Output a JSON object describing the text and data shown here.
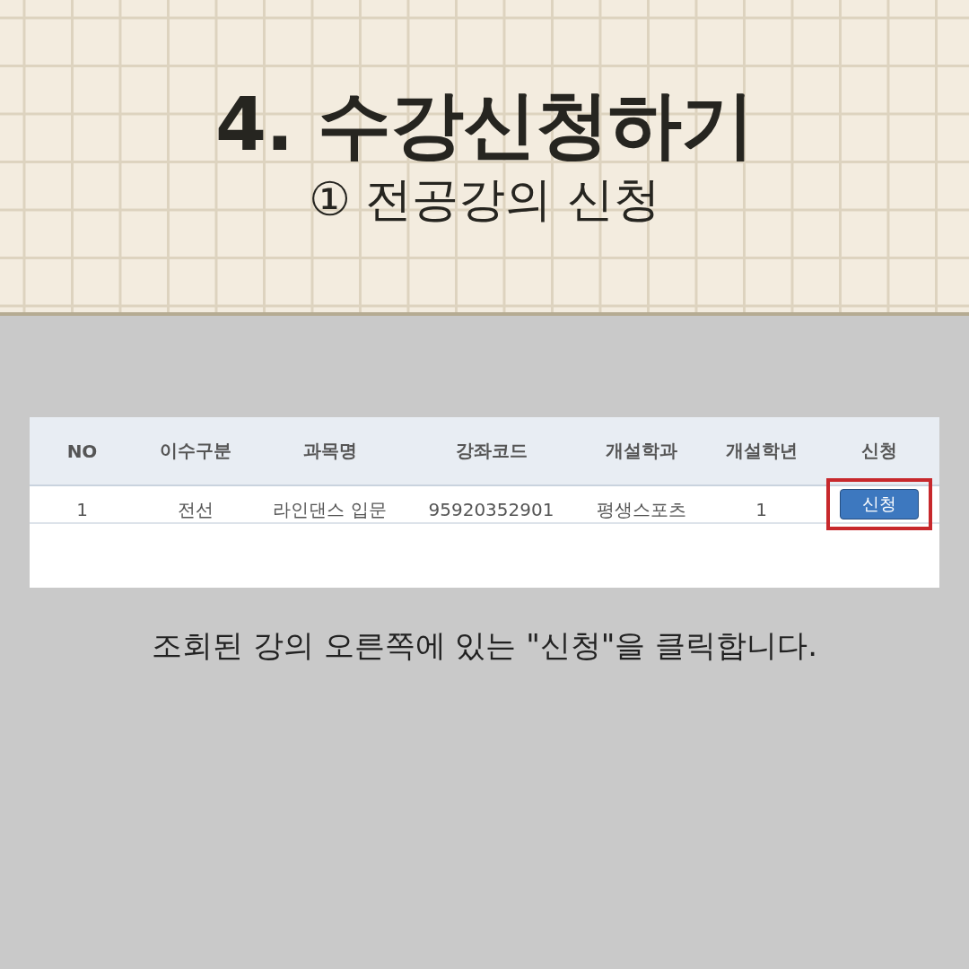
{
  "title": "4. 수강신청하기",
  "subtitle": "① 전공강의 신청",
  "table": {
    "columns": [
      "NO",
      "이수구분",
      "과목명",
      "강좌코드",
      "개설학과",
      "개설학년",
      "신청"
    ],
    "rows": [
      {
        "cells": [
          "1",
          "전선",
          "라인댄스 입문",
          "95920352901",
          "평생스포츠",
          "1"
        ],
        "button": "신청",
        "highlighted": true
      }
    ]
  },
  "caption": "조회된 강의 오른쪽에 있는 \"신청\"을 클릭합니다."
}
